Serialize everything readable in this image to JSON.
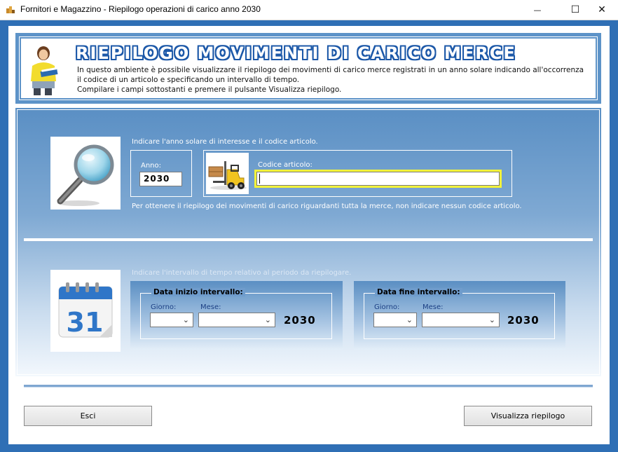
{
  "window": {
    "title": "Fornitori e Magazzino - Riepilogo operazioni di carico anno 2030",
    "minimize": "—",
    "maximize": "☐",
    "close": "✕"
  },
  "header": {
    "title": "RIEPILOGO MOVIMENTI DI CARICO MERCE",
    "lines": [
      "In questo ambiente è possibile visualizzare il riepilogo dei movimenti di carico merce registrati in un anno solare indicando all'occorrenza",
      "il codice di un articolo e specificando un intervallo di tempo.",
      "Compilare i campi sottostanti e premere il pulsante Visualizza riepilogo."
    ]
  },
  "article_section": {
    "instruction": "Indicare l'anno solare di interesse e il codice articolo.",
    "anno_label": "Anno:",
    "anno_value": "2030",
    "codice_label": "Codice articolo:",
    "codice_value": "",
    "note": "Per ottenere il riepilogo dei movimenti di carico riguardanti tutta la merce, non indicare nessun codice articolo."
  },
  "interval_section": {
    "instruction": "Indicare l'intervallo di tempo relativo al periodo da riepilogare.",
    "calendar_day": "31",
    "start": {
      "legend": "Data inizio intervallo:",
      "giorno_label": "Giorno:",
      "mese_label": "Mese:",
      "giorno_value": "",
      "mese_value": "",
      "year": "2030"
    },
    "end": {
      "legend": "Data fine intervallo:",
      "giorno_label": "Giorno:",
      "mese_label": "Mese:",
      "giorno_value": "",
      "mese_value": "",
      "year": "2030"
    }
  },
  "buttons": {
    "exit": "Esci",
    "show": "Visualizza riepilogo"
  },
  "colors": {
    "frame": "#2f6fb5",
    "title_outline": "#1c58a8",
    "highlight": "#f2f23a"
  }
}
